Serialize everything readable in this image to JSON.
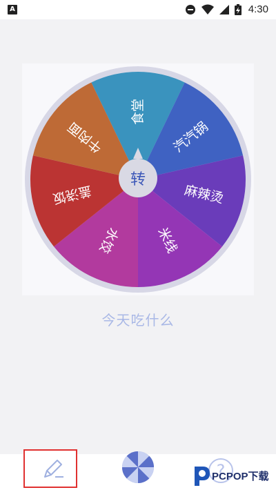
{
  "status_bar": {
    "app_badge": "A",
    "time": "4:30"
  },
  "wheel": {
    "center_label": "转",
    "segments": [
      {
        "label": "食堂",
        "color": "#3a93be"
      },
      {
        "label": "汽汽锅",
        "color": "#3f62c2"
      },
      {
        "label": "麻辣烫",
        "color": "#6a3cba"
      },
      {
        "label": "米线",
        "color": "#9436b5"
      },
      {
        "label": "水饺",
        "color": "#b23a9e"
      },
      {
        "label": "盖浇饭",
        "color": "#bb3433"
      },
      {
        "label": "牛肉面",
        "color": "#be6a36"
      }
    ],
    "rim_color": "#d7d7e6"
  },
  "caption": "今天吃什么",
  "bottom_bar": {
    "help_label": "?"
  },
  "watermark": {
    "text": "PCPOP下载"
  }
}
